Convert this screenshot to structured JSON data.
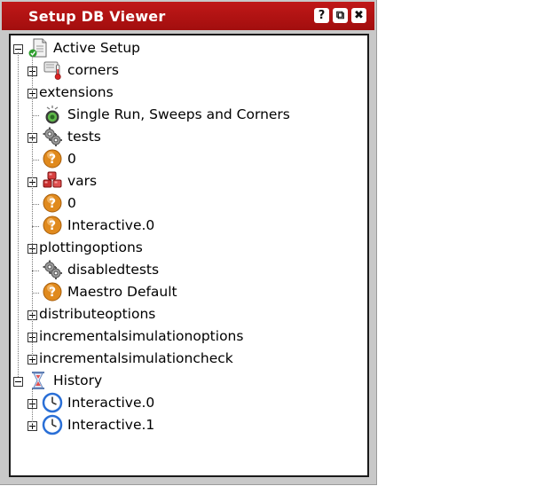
{
  "window": {
    "title": "Setup DB Viewer",
    "buttons": {
      "help": "?",
      "float": "⧉",
      "close": "✖"
    }
  },
  "tree": {
    "root": {
      "label": "Active Setup",
      "icon": "document-setup-icon",
      "expanded": true
    },
    "items": [
      {
        "label": "corners",
        "icon": "thermometer-icon",
        "expandable": true
      },
      {
        "label": "extensions",
        "icon": "",
        "expandable": true
      },
      {
        "label": "Single Run, Sweeps and Corners",
        "icon": "run-target-icon",
        "expandable": false
      },
      {
        "label": "tests",
        "icon": "gears-icon",
        "expandable": true
      },
      {
        "label": "0",
        "icon": "question-icon",
        "expandable": false
      },
      {
        "label": "vars",
        "icon": "vars-cubes-icon",
        "expandable": true
      },
      {
        "label": "0",
        "icon": "question-icon",
        "expandable": false
      },
      {
        "label": "Interactive.0",
        "icon": "question-icon",
        "expandable": false
      },
      {
        "label": "plottingoptions",
        "icon": "",
        "expandable": true
      },
      {
        "label": "disabledtests",
        "icon": "gears-icon",
        "expandable": false
      },
      {
        "label": "Maestro Default",
        "icon": "question-icon",
        "expandable": false
      },
      {
        "label": "distributeoptions",
        "icon": "",
        "expandable": true
      },
      {
        "label": "incrementalsimulationoptions",
        "icon": "",
        "expandable": true
      },
      {
        "label": "incrementalsimulationcheck",
        "icon": "",
        "expandable": true
      }
    ],
    "history": {
      "label": "History",
      "icon": "hourglass-icon",
      "expanded": true,
      "items": [
        {
          "label": "Interactive.0",
          "icon": "clock-icon",
          "expandable": true
        },
        {
          "label": "Interactive.1",
          "icon": "clock-icon",
          "expandable": true
        }
      ]
    }
  },
  "colors": {
    "titlebar": "#b01212",
    "panel": "#c8c8c8",
    "question": "#e08a1e",
    "clock": "#2a6fd6"
  }
}
